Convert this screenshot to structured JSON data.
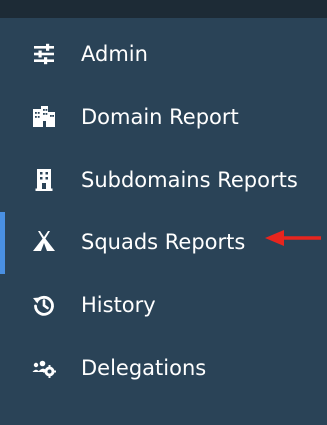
{
  "sidebar": {
    "items": [
      {
        "label": "Admin",
        "icon": "sliders-icon"
      },
      {
        "label": "Domain Report",
        "icon": "buildings-icon"
      },
      {
        "label": "Subdomains Reports",
        "icon": "building-icon"
      },
      {
        "label": "Squads Reports",
        "icon": "tent-icon",
        "active": true
      },
      {
        "label": "History",
        "icon": "history-icon"
      },
      {
        "label": "Delegations",
        "icon": "users-gear-icon"
      }
    ]
  },
  "colors": {
    "sidebar_bg": "#2a4357",
    "topbar_bg": "#1d2b36",
    "active_indicator": "#4a90e2",
    "annotation_arrow": "#e8251e",
    "text": "#ffffff"
  }
}
